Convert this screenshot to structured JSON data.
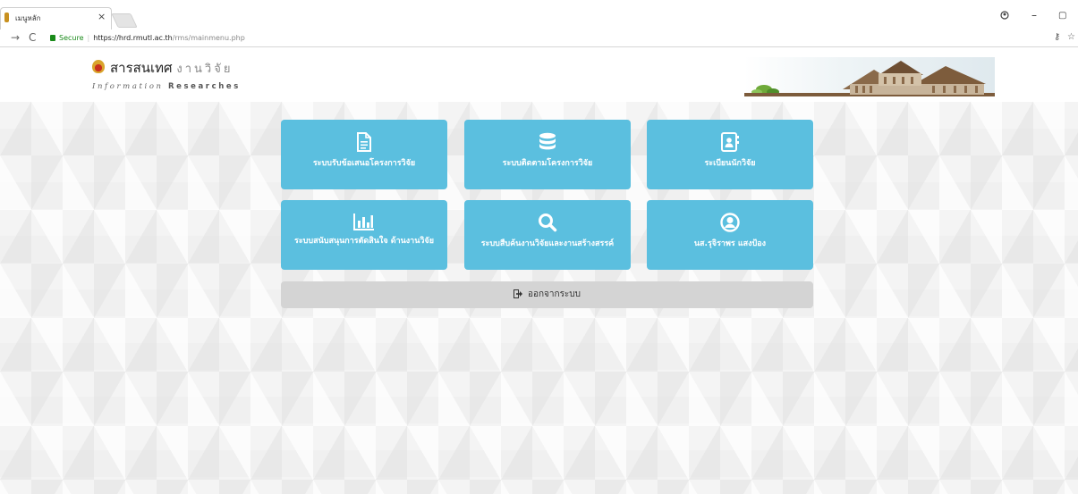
{
  "browser": {
    "tab_title": "เมนูหลัก",
    "tab_close": "×",
    "secure_label": "Secure",
    "url_host": "https://hrd.rmutl.ac.th",
    "url_path": "/rms/mainmenu.php",
    "win_minimize": "–",
    "win_restore": "▢",
    "profile_icon": "profile-icon"
  },
  "header": {
    "logo_th_main": "สารสนเทศ",
    "logo_th_sub": "งานวิจัย",
    "logo_en_italic": "Information",
    "logo_en_bold": "Researches"
  },
  "menu": {
    "tiles": [
      {
        "label": "ระบบรับข้อเสนอโครงการวิจัย",
        "icon": "document-icon"
      },
      {
        "label": "ระบบติดตามโครงการวิจัย",
        "icon": "database-icon"
      },
      {
        "label": "ระเบียนนักวิจัย",
        "icon": "contact-book-icon"
      },
      {
        "label": "ระบบสนับสนุนการตัดสินใจ ด้านงานวิจัย",
        "icon": "bar-chart-icon"
      },
      {
        "label": "ระบบสืบค้นงานวิจัยและงานสร้างสรรค์",
        "icon": "search-icon"
      },
      {
        "label": "นส.รุจิราพร แสงป้อง",
        "icon": "user-icon"
      }
    ],
    "logout_label": "ออกจากระบบ"
  },
  "colors": {
    "tile": "#5bbfdf",
    "logout": "#d4d4d4",
    "secure": "#1a8a1a"
  }
}
